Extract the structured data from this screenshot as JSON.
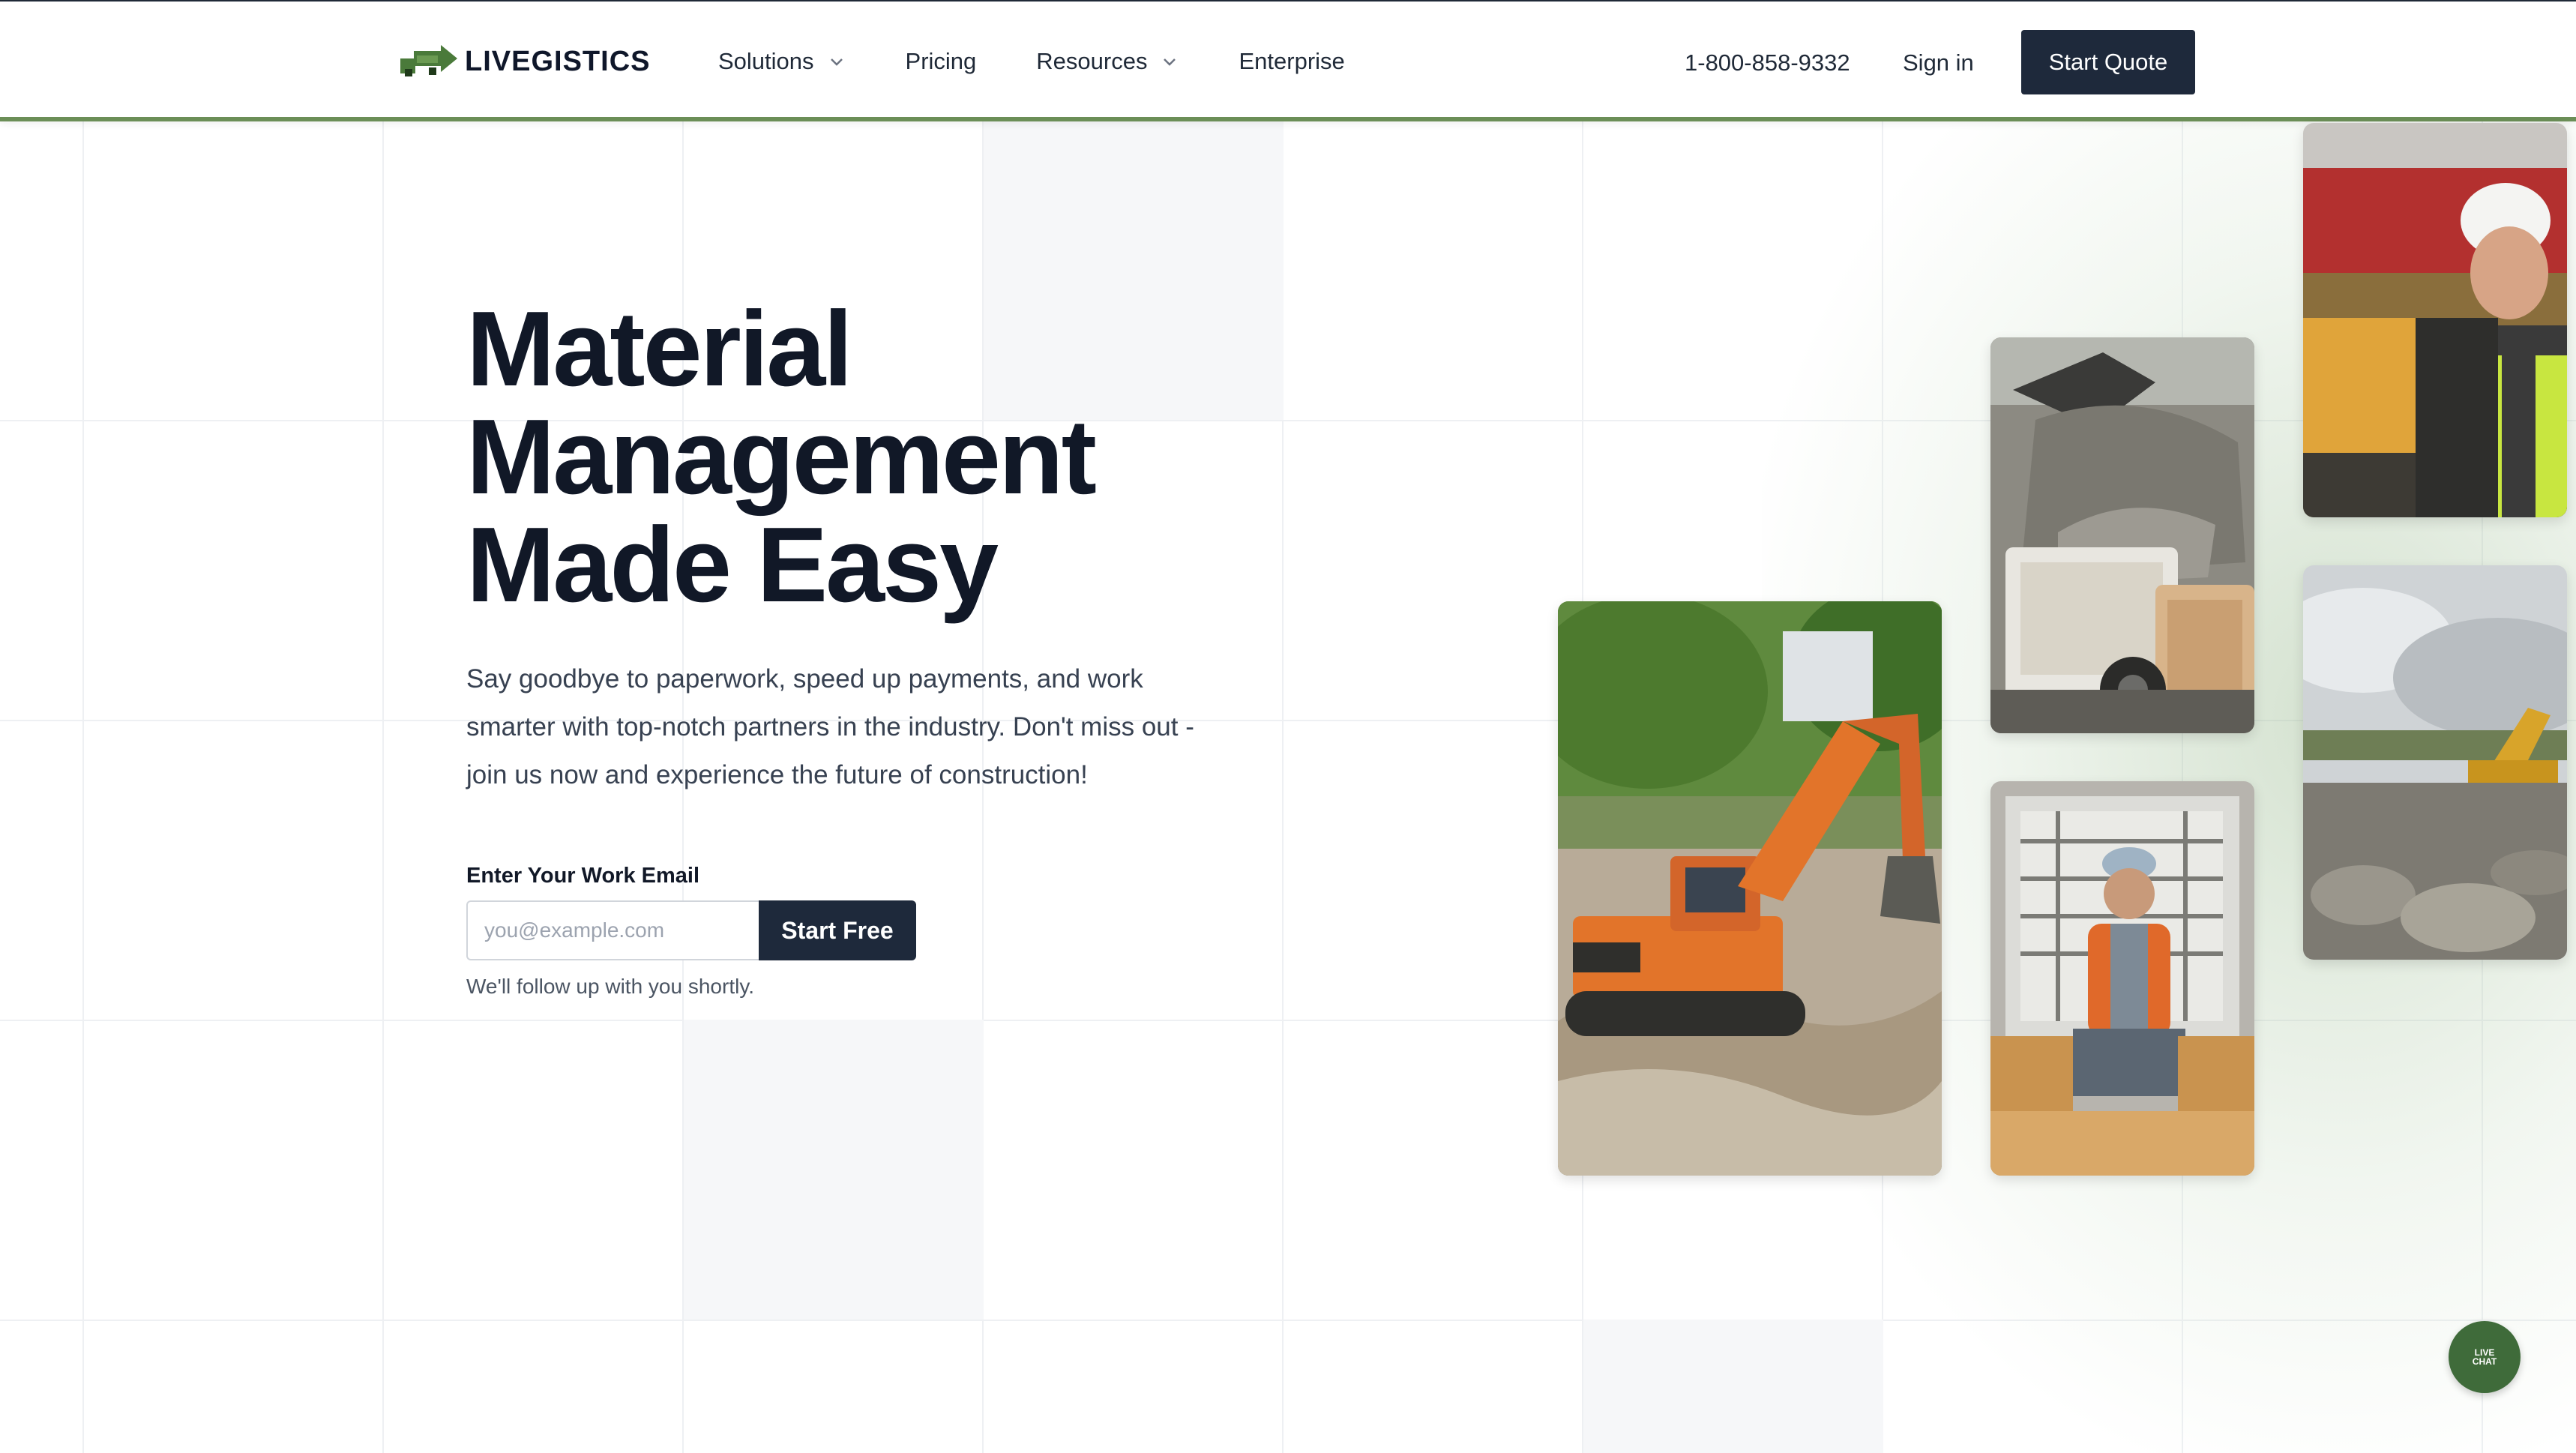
{
  "header": {
    "logo_text": "LIVEGISTICS",
    "nav": {
      "solutions": "Solutions",
      "pricing": "Pricing",
      "resources": "Resources",
      "enterprise": "Enterprise"
    },
    "phone": "1-800-858-9332",
    "signin": "Sign in",
    "quote_button": "Start Quote"
  },
  "hero": {
    "title_line1": "Material",
    "title_line2": "Management",
    "title_line3": "Made Easy",
    "subtitle": "Say goodbye to paperwork, speed up payments, and work smarter with top-notch partners in the industry. Don't miss out - join us now and experience the future of construction!",
    "email_label": "Enter Your Work Email",
    "email_placeholder": "you@example.com",
    "start_button": "Start Free",
    "followup": "We'll follow up with you shortly."
  },
  "chat": {
    "label_line1": "LIVE",
    "label_line2": "CHAT"
  },
  "colors": {
    "brand_green": "#6b8e57",
    "dark_button": "#1e293b",
    "chat_green": "#3f6b3a"
  },
  "icons": [
    "logo-icon",
    "chevron-down-icon",
    "chat-icon"
  ]
}
